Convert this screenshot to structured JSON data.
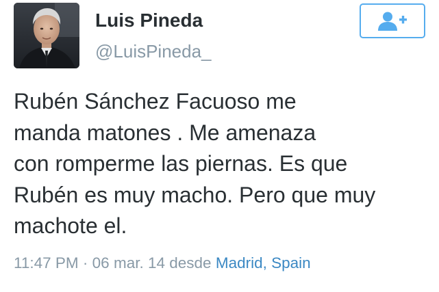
{
  "user": {
    "name": "Luis Pineda",
    "handle": "@LuisPineda_"
  },
  "follow_button": {
    "icon": "follow-user-plus-icon",
    "color": "#55acee"
  },
  "tweet": {
    "lines": [
      "Rubén Sánchez Facuoso me",
      "manda matones . Me amenaza",
      "con romperme las piernas. Es que",
      "Rubén es muy macho. Pero que muy",
      "machote el."
    ],
    "time": "11:47 PM",
    "separator": "·",
    "date": "06 mar. 14",
    "from_label": "desde",
    "location": "Madrid, Spain"
  },
  "colors": {
    "text": "#292f33",
    "muted": "#8899a6",
    "link": "#3b88c3",
    "accent": "#55acee"
  }
}
